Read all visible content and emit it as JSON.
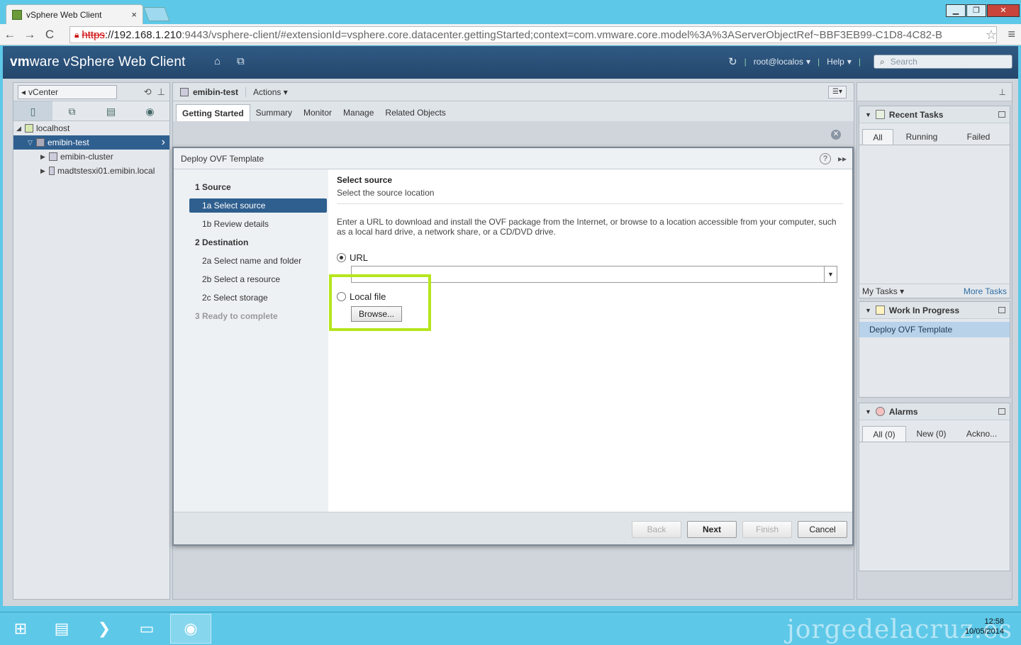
{
  "browser": {
    "tab_title": "vSphere Web Client",
    "tab_close": "×",
    "url_scheme": "https",
    "url_host": "://192.168.1.210",
    "url_rest": ":9443/vsphere-client/#extensionId=vsphere.core.datacenter.gettingStarted;context=com.vmware.core.model%3A%3AServerObjectRef~BBF3EB99-C1D8-4C82-B",
    "back": "←",
    "forward": "→",
    "reload": "C",
    "star": "☆",
    "menu": "≡",
    "win_min": "▁",
    "win_max": "❐",
    "win_close": "✕"
  },
  "header": {
    "brand_vm": "vm",
    "brand_ware": "ware",
    "product": " vSphere Web Client",
    "home_icon": "⌂",
    "history_icon": "⧉",
    "refresh_icon": "↻",
    "user": "root@localos",
    "help": "Help",
    "search_placeholder": "Search",
    "sep": "|",
    "caret": "▾"
  },
  "nav": {
    "vcenter_label": "vCenter",
    "tabs": [
      "▯",
      "⧉",
      "▤",
      "◉"
    ],
    "tree": [
      {
        "label": "localhost",
        "twisty": "◢",
        "level": 0
      },
      {
        "label": "emibin-test",
        "twisty": "▽",
        "level": 1,
        "selected": true
      },
      {
        "label": "emibin-cluster",
        "twisty": "▶",
        "level": 2
      },
      {
        "label": "madtstesxi01.emibin.local",
        "twisty": "▶",
        "level": 2
      }
    ],
    "selected_arrow": "›"
  },
  "object": {
    "name": "emibin-test",
    "actions": "Actions ▾",
    "tabs": [
      "Getting Started",
      "Summary",
      "Monitor",
      "Manage",
      "Related Objects"
    ]
  },
  "dialog": {
    "title": "Deploy OVF Template",
    "help": "?",
    "expand": "▸▸",
    "steps": [
      {
        "label": "1   Source",
        "kind": "lvl1"
      },
      {
        "label": "1a  Select source",
        "kind": "sel"
      },
      {
        "label": "1b  Review details",
        "kind": "lvl2"
      },
      {
        "label": "2   Destination",
        "kind": "lvl1"
      },
      {
        "label": "2a  Select name and folder",
        "kind": "lvl2"
      },
      {
        "label": "2b  Select a resource",
        "kind": "lvl2"
      },
      {
        "label": "2c  Select storage",
        "kind": "lvl2"
      },
      {
        "label": "3   Ready to complete",
        "kind": "dis"
      }
    ],
    "section_title": "Select source",
    "section_subtitle": "Select the source location",
    "description": "Enter a URL to download and install the OVF package from the Internet, or browse to a location accessible from your computer, such as a local hard drive, a network share, or a CD/DVD drive.",
    "url_option": "URL",
    "url_value": "",
    "local_option": "Local file",
    "browse": "Browse...",
    "buttons": {
      "back": "Back",
      "next": "Next",
      "finish": "Finish",
      "cancel": "Cancel"
    }
  },
  "right": {
    "recent_tasks": {
      "title": "Recent Tasks",
      "tabs": [
        "All",
        "Running",
        "Failed"
      ],
      "my_tasks": "My Tasks ▾",
      "more_tasks": "More Tasks"
    },
    "wip": {
      "title": "Work In Progress",
      "item": "Deploy OVF Template"
    },
    "alarms": {
      "title": "Alarms",
      "tabs": [
        "All (0)",
        "New (0)",
        "Ackno..."
      ]
    }
  },
  "taskbar": {
    "time": "12:58",
    "date": "10/05/2014",
    "watermark": "jorgedelacruz.es"
  }
}
